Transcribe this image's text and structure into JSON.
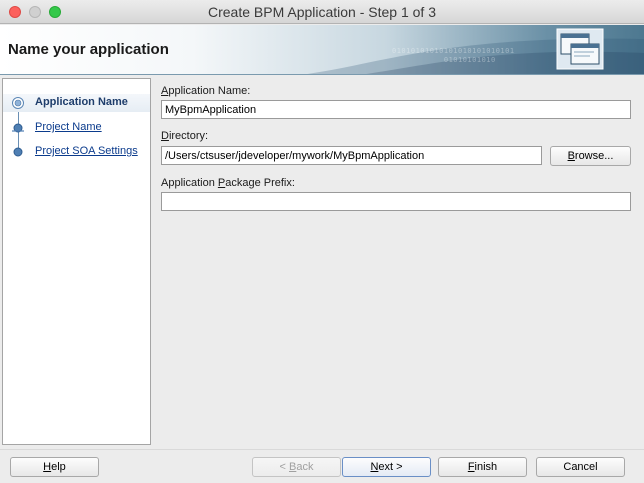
{
  "window": {
    "title": "Create BPM Application - Step 1 of 3"
  },
  "banner": {
    "heading": "Name your application",
    "binary_decoration": "01010101010101010101010101\n           01010101010"
  },
  "navigation": {
    "steps": [
      {
        "label": "Application Name",
        "state": "current"
      },
      {
        "label": "Project Name",
        "state": "link"
      },
      {
        "label": "Project SOA Settings",
        "state": "link"
      }
    ]
  },
  "form": {
    "app_name": {
      "label_mnemonic": "A",
      "label_rest": "pplication Name:",
      "value": "MyBpmApplication"
    },
    "directory": {
      "label_mnemonic": "D",
      "label_rest": "irectory:",
      "value": "/Users/ctsuser/jdeveloper/mywork/MyBpmApplication"
    },
    "browse_button": {
      "mnemonic": "B",
      "rest": "rowse..."
    },
    "package_prefix": {
      "label_before": "Application ",
      "label_mnemonic": "P",
      "label_rest": "ackage Prefix:",
      "value": ""
    }
  },
  "footer": {
    "help": {
      "mnemonic": "H",
      "rest": "elp"
    },
    "back": {
      "text": "< ",
      "mnemonic": "B",
      "rest": "ack",
      "enabled": false
    },
    "next": {
      "mnemonic": "N",
      "rest": "ext >"
    },
    "finish": {
      "mnemonic": "F",
      "rest": "inish"
    },
    "cancel": {
      "label": "Cancel"
    }
  },
  "colors": {
    "accent": "#1e3d6b",
    "link": "#0b3b8c",
    "close": "#fc615d",
    "maximize": "#34c84a"
  }
}
